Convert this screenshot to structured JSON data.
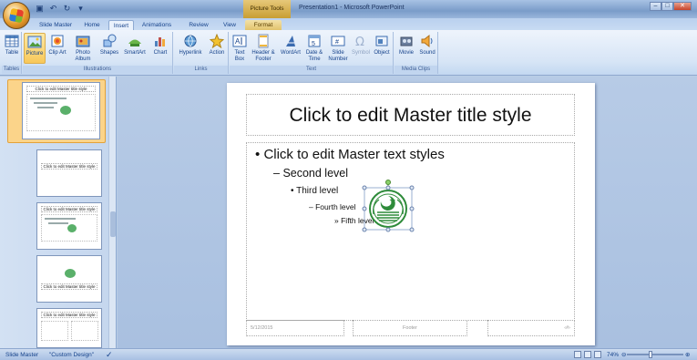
{
  "window": {
    "title": "Presentation1 - Microsoft PowerPoint",
    "contextual_tab": "Picture Tools",
    "controls": [
      "–",
      "□",
      "✕"
    ]
  },
  "quick_access": {
    "save_icon": "save-icon",
    "undo_icon": "undo-icon",
    "redo_icon": "redo-icon"
  },
  "tabs": [
    {
      "label": "Slide Master"
    },
    {
      "label": "Home"
    },
    {
      "label": "Insert",
      "active": true
    },
    {
      "label": "Animations"
    },
    {
      "label": "Review"
    },
    {
      "label": "View"
    },
    {
      "label": "Format"
    }
  ],
  "ribbon": {
    "groups": [
      {
        "label": "Tables",
        "buttons": [
          {
            "label": "Table",
            "icon": "table-icon"
          }
        ]
      },
      {
        "label": "Illustrations",
        "buttons": [
          {
            "label": "Picture",
            "icon": "picture-icon",
            "highlighted": true
          },
          {
            "label": "Clip Art",
            "icon": "clip-art-icon"
          },
          {
            "label": "Photo Album",
            "icon": "photo-album-icon"
          },
          {
            "label": "Shapes",
            "icon": "shapes-icon"
          },
          {
            "label": "SmartArt",
            "icon": "smartart-icon"
          },
          {
            "label": "Chart",
            "icon": "chart-icon"
          }
        ]
      },
      {
        "label": "Links",
        "buttons": [
          {
            "label": "Hyperlink",
            "icon": "hyperlink-icon"
          },
          {
            "label": "Action",
            "icon": "action-icon"
          }
        ]
      },
      {
        "label": "Text",
        "buttons": [
          {
            "label": "Text Box",
            "icon": "text-box-icon"
          },
          {
            "label": "Header & Footer",
            "icon": "header-footer-icon"
          },
          {
            "label": "WordArt",
            "icon": "wordart-icon"
          },
          {
            "label": "Date & Time",
            "icon": "date-time-icon"
          },
          {
            "label": "Slide Number",
            "icon": "slide-number-icon"
          },
          {
            "label": "Symbol",
            "icon": "symbol-icon",
            "disabled": true
          },
          {
            "label": "Object",
            "icon": "object-icon"
          }
        ]
      },
      {
        "label": "Media Clips",
        "buttons": [
          {
            "label": "Movie",
            "icon": "movie-icon"
          },
          {
            "label": "Sound",
            "icon": "sound-icon"
          }
        ]
      }
    ]
  },
  "thumbnails": {
    "master_title": "Click to edit Master title style",
    "layouts": [
      {
        "title": "Click to edit Master title style"
      },
      {
        "title": "Click to edit Master title style"
      },
      {
        "title": "Click to edit Master title style"
      },
      {
        "title": "Click to edit Master title style"
      }
    ]
  },
  "slide": {
    "title": "Click to edit Master title style",
    "levels": [
      "Click to edit Master text styles",
      "Second level",
      "Third level",
      "Fourth level",
      "Fifth level"
    ],
    "bullets": [
      "•",
      "–",
      "•",
      "–",
      "»"
    ],
    "date": "5/12/2015",
    "footer": "Footer",
    "number": "‹#›"
  },
  "statusbar": {
    "view": "Slide Master",
    "theme": "\"Custom Design\"",
    "zoom": "74%"
  },
  "colors": {
    "ribbon_accent": "#f8c85a",
    "selection": "#fbd48a",
    "emblem_green": "#2e8b3a"
  }
}
